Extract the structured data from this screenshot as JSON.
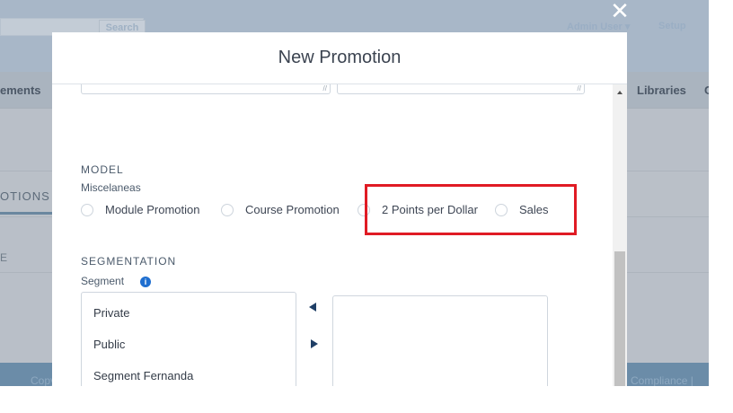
{
  "background": {
    "search_button": "Search",
    "admin_user": "Admin User",
    "setup": "Setup",
    "nav_left_partial": "ements",
    "nav_libraries": "Libraries",
    "nav_right_partial": "C",
    "promotions_tab_partial": "OTIONS",
    "column_partial": "E",
    "footer_left_partial": "Copy",
    "footer_right_partial": "Compliance | Go"
  },
  "modal": {
    "title": "New Promotion",
    "model_section": {
      "title": "MODEL",
      "group_label": "Miscelaneas",
      "options": [
        "Module Promotion",
        "Course Promotion",
        "2 Points per Dollar",
        "Sales"
      ]
    },
    "segmentation_section": {
      "title": "SEGMENTATION",
      "segment_label": "Segment",
      "available_segments": [
        "Private",
        "Public",
        "Segment Fernanda"
      ],
      "selected_segments": []
    }
  },
  "icons": {
    "close": "close-icon",
    "info": "info-icon",
    "move_left": "arrow-left-icon",
    "move_right": "arrow-right-icon"
  },
  "colors": {
    "highlight_border": "#e01b24",
    "info_icon": "#1f6fd0",
    "overlay": "#b9bfc8",
    "footer": "#6b8ca8"
  }
}
